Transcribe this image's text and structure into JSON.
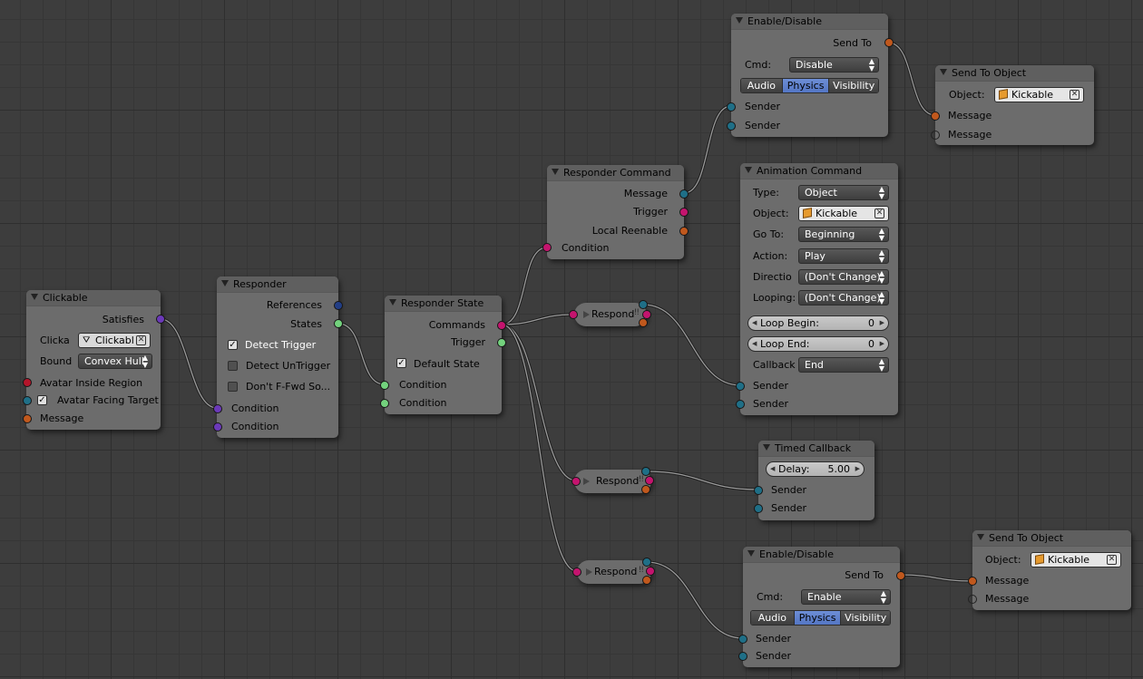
{
  "nodes": {
    "clickable": {
      "title": "Clickable",
      "satisfies": "Satisfies",
      "clicka_label": "Clicka",
      "clicka_value": "Clickabl",
      "bound_label": "Bound",
      "bound_value": "Convex Hull",
      "avatar_inside": "Avatar Inside Region",
      "avatar_facing": "Avatar Facing Target",
      "message": "Message"
    },
    "responder": {
      "title": "Responder",
      "references": "References",
      "states": "States",
      "detect_trigger": "Detect Trigger",
      "detect_untrigger": "Detect UnTrigger",
      "dont_ffwd": "Don't F-Fwd So...",
      "condition1": "Condition",
      "condition2": "Condition"
    },
    "responder_state": {
      "title": "Responder State",
      "commands": "Commands",
      "trigger": "Trigger",
      "default_state": "Default State",
      "condition1": "Condition",
      "condition2": "Condition"
    },
    "responder_command": {
      "title": "Responder Command",
      "message": "Message",
      "trigger": "Trigger",
      "local_reenable": "Local Reenable",
      "condition": "Condition"
    },
    "respond_nodes": [
      "Respond",
      "Respond",
      "Respond"
    ],
    "enable_disable_1": {
      "title": "Enable/Disable",
      "send_to": "Send To",
      "cmd_label": "Cmd:",
      "cmd_value": "Disable",
      "toggles": [
        "Audio",
        "Physics",
        "Visibility"
      ],
      "active_toggle": "Physics",
      "sender1": "Sender",
      "sender2": "Sender"
    },
    "send_to_object_1": {
      "title": "Send To Object",
      "object_label": "Object:",
      "object_value": "Kickable",
      "message1": "Message",
      "message2": "Message"
    },
    "animation_command": {
      "title": "Animation Command",
      "fields": [
        {
          "label": "Type:",
          "value": "Object"
        },
        {
          "label": "Object:",
          "value": "Kickable"
        },
        {
          "label": "Go To:",
          "value": "Beginning"
        },
        {
          "label": "Action:",
          "value": "Play"
        },
        {
          "label": "Directio",
          "value": "(Don't Change)"
        },
        {
          "label": "Looping:",
          "value": "(Don't Change)"
        }
      ],
      "loop_begin_label": "Loop Begin:",
      "loop_begin_value": "0",
      "loop_end_label": "Loop End:",
      "loop_end_value": "0",
      "callback_label": "Callback",
      "callback_value": "End",
      "sender1": "Sender",
      "sender2": "Sender"
    },
    "timed_callback": {
      "title": "Timed Callback",
      "delay_label": "Delay:",
      "delay_value": "5.00",
      "sender1": "Sender",
      "sender2": "Sender"
    },
    "enable_disable_2": {
      "title": "Enable/Disable",
      "send_to": "Send To",
      "cmd_label": "Cmd:",
      "cmd_value": "Enable",
      "toggles": [
        "Audio",
        "Physics",
        "Visibility"
      ],
      "active_toggle": "Physics",
      "sender1": "Sender",
      "sender2": "Sender"
    },
    "send_to_object_2": {
      "title": "Send To Object",
      "object_label": "Object:",
      "object_value": "Kickable",
      "message1": "Message",
      "message2": "Message"
    }
  },
  "colors": {
    "background": "#3d3d3d",
    "node_body": "#6c6c6c",
    "socket_purple": "#6b39b8",
    "socket_green": "#73d27d",
    "socket_teal": "#1f6f87",
    "socket_magenta": "#c4146e",
    "socket_orange": "#c0581d",
    "toggle_active": "#5f82cc"
  }
}
